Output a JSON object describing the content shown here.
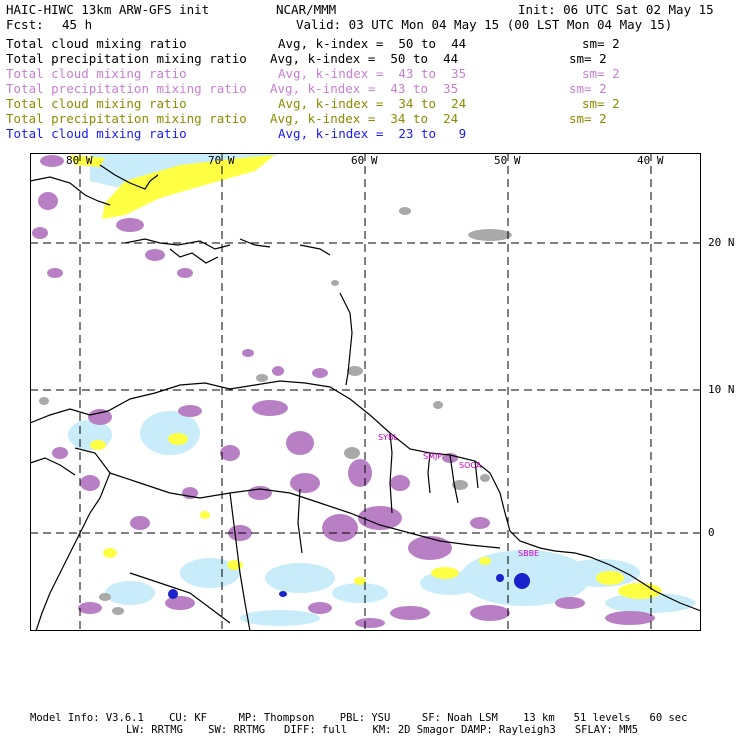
{
  "header": {
    "model_title": "HAIC-HIWC 13km ARW-GFS init",
    "org": "NCAR/MMM",
    "init_time": "Init: 06 UTC Sat 02 May 15",
    "forecast_label": "Fcst:",
    "forecast_hours": "45 h",
    "valid_time": "Valid: 03 UTC Mon 04 May 15 (00 LST Mon 04 May 15)"
  },
  "legend": [
    {
      "field": "Total cloud mixing ratio",
      "range": "Avg, k-index =  50 to  44",
      "smoothing": "sm= 2",
      "color": "#000000"
    },
    {
      "field": "Total precipitation mixing ratio",
      "range": "Avg, k-index =  50 to  44",
      "smoothing": "sm= 2",
      "color": "#000000"
    },
    {
      "field": "Total cloud mixing ratio",
      "range": "Avg, k-index =  43 to  35",
      "smoothing": "sm= 2",
      "color": "#c77fd0"
    },
    {
      "field": "Total precipitation mixing ratio",
      "range": "Avg, k-index =  43 to  35",
      "smoothing": "sm= 2",
      "color": "#c77fd0"
    },
    {
      "field": "Total cloud mixing ratio",
      "range": "Avg, k-index =  34 to  24",
      "smoothing": "sm= 2",
      "color": "#8c8c00"
    },
    {
      "field": "Total precipitation mixing ratio",
      "range": "Avg, k-index =  34 to  24",
      "smoothing": "sm= 2",
      "color": "#8c8c00"
    },
    {
      "field": "Total cloud mixing ratio",
      "range": "Avg, k-index =  23 to   9",
      "smoothing": "",
      "color": "#1a1aff"
    }
  ],
  "map": {
    "longitude_labels": [
      "80 W",
      "70 W",
      "60 W",
      "50 W",
      "40 W"
    ],
    "latitude_labels": [
      "20 N",
      "10 N",
      "0"
    ],
    "station_labels": [
      "SYBL",
      "SMJP",
      "SOCA",
      "SBBE"
    ],
    "colors": {
      "high_cloud": "#a9a9a9",
      "mid_cloud": "#b87fc4",
      "low_cloud": "#ffff44",
      "lowest_cloud": "#c8ecfa",
      "convective_core": "#1a22cc",
      "station": "#cc00cc",
      "coast": "#000000"
    }
  },
  "footer": {
    "line1": "Model Info: V3.6.1    CU: KF     MP: Thompson    PBL: YSU     SF: Noah LSM    13 km   51 levels   60 sec",
    "line2": "LW: RRTMG    SW: RRTMG   DIFF: full    KM: 2D Smagor DAMP: Rayleigh3   SFLAY: MM5"
  }
}
